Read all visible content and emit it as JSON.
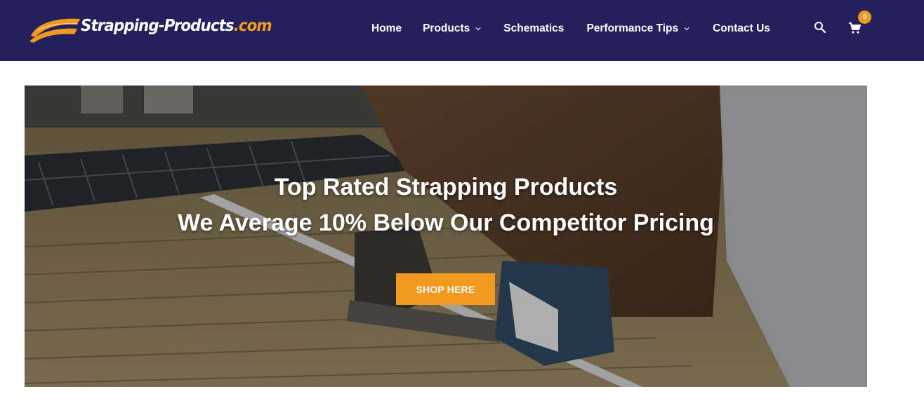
{
  "brand": {
    "logo_main": "Strapping-Products",
    "logo_domain": ".com",
    "accent_color": "#f29a1f",
    "header_color": "#241f5d"
  },
  "nav": {
    "items": [
      {
        "label": "Home",
        "dropdown": false
      },
      {
        "label": "Products",
        "dropdown": true
      },
      {
        "label": "Schematics",
        "dropdown": false
      },
      {
        "label": "Performance Tips",
        "dropdown": true
      },
      {
        "label": "Contact Us",
        "dropdown": false
      }
    ],
    "search_icon": "search-icon",
    "cart_icon": "cart-icon",
    "cart_count": "0"
  },
  "hero": {
    "line1": "Top Rated Strapping Products",
    "line2": "We Average 10% Below Our Competitor Pricing",
    "cta_label": "SHOP HERE",
    "background_image": "worker-strapping-lumber-photo"
  }
}
